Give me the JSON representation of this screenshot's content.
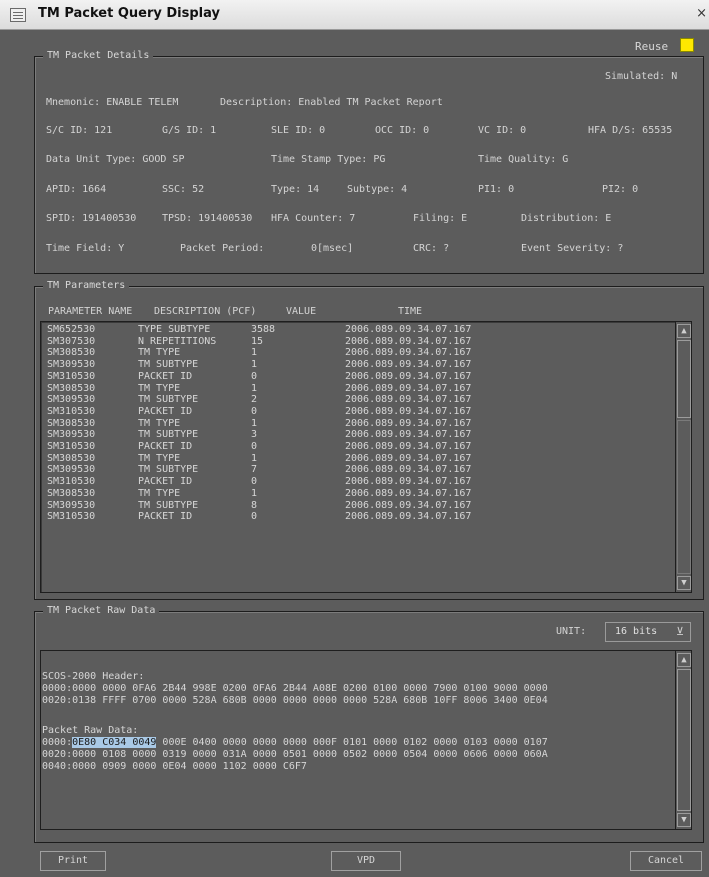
{
  "window": {
    "title": "TM Packet Query Display",
    "close_glyph": "×"
  },
  "reuse": {
    "label": "Reuse",
    "color": "#ffe800"
  },
  "details": {
    "group_label": "TM Packet Details",
    "simulated": "Simulated: N",
    "mnemonic": "Mnemonic: ENABLE TELEM",
    "description": "Description: Enabled TM Packet Report",
    "sc_id": "S/C ID: 121",
    "gs_id": "G/S ID: 1",
    "sle_id": "SLE ID: 0",
    "occ_id": "OCC ID: 0",
    "vc_id": "VC ID: 0",
    "hfa_ds": "HFA D/S: 65535",
    "data_unit_type": "Data Unit Type: GOOD SP",
    "time_stamp_type": "Time Stamp Type: PG",
    "time_quality": "Time Quality: G",
    "apid": "APID: 1664",
    "ssc": "SSC: 52",
    "type": "Type: 14",
    "subtype": "Subtype: 4",
    "pi1": "PI1: 0",
    "pi2": "PI2: 0",
    "spid": "SPID: 191400530",
    "tpsd": "TPSD: 191400530",
    "hfa_counter": "HFA Counter: 7",
    "filing": "Filing: E",
    "distribution": "Distribution: E",
    "time_field": "Time Field: Y",
    "packet_period_label": "Packet Period:",
    "packet_period_value": "0[msec]",
    "crc": "CRC: ?",
    "event_severity": "Event Severity: ?"
  },
  "parameters": {
    "group_label": "TM Parameters",
    "headers": [
      "PARAMETER NAME",
      "DESCRIPTION (PCF)",
      "VALUE",
      "TIME"
    ],
    "rows": [
      [
        "SM652530",
        "TYPE SUBTYPE",
        "3588",
        "2006.089.09.34.07.167"
      ],
      [
        "SM307530",
        "N REPETITIONS",
        "15",
        "2006.089.09.34.07.167"
      ],
      [
        "SM308530",
        "TM TYPE",
        "1",
        "2006.089.09.34.07.167"
      ],
      [
        "SM309530",
        "TM SUBTYPE",
        "1",
        "2006.089.09.34.07.167"
      ],
      [
        "SM310530",
        "PACKET ID",
        "0",
        "2006.089.09.34.07.167"
      ],
      [
        "SM308530",
        "TM TYPE",
        "1",
        "2006.089.09.34.07.167"
      ],
      [
        "SM309530",
        "TM SUBTYPE",
        "2",
        "2006.089.09.34.07.167"
      ],
      [
        "SM310530",
        "PACKET ID",
        "0",
        "2006.089.09.34.07.167"
      ],
      [
        "SM308530",
        "TM TYPE",
        "1",
        "2006.089.09.34.07.167"
      ],
      [
        "SM309530",
        "TM SUBTYPE",
        "3",
        "2006.089.09.34.07.167"
      ],
      [
        "SM310530",
        "PACKET ID",
        "0",
        "2006.089.09.34.07.167"
      ],
      [
        "SM308530",
        "TM TYPE",
        "1",
        "2006.089.09.34.07.167"
      ],
      [
        "SM309530",
        "TM SUBTYPE",
        "7",
        "2006.089.09.34.07.167"
      ],
      [
        "SM310530",
        "PACKET ID",
        "0",
        "2006.089.09.34.07.167"
      ],
      [
        "SM308530",
        "TM TYPE",
        "1",
        "2006.089.09.34.07.167"
      ],
      [
        "SM309530",
        "TM SUBTYPE",
        "8",
        "2006.089.09.34.07.167"
      ],
      [
        "SM310530",
        "PACKET ID",
        "0",
        "2006.089.09.34.07.167"
      ]
    ]
  },
  "raw": {
    "group_label": "TM Packet Raw Data",
    "unit_label": "UNIT:",
    "unit_value": "16 bits",
    "scos_header_title": "SCOS-2000 Header:",
    "scos_lines": [
      "0000:0000 0000 0FA6 2B44 998E 0200 0FA6 2B44 A08E 0200 0100 0000 7900 0100 9000 0000",
      "0020:0138 FFFF 0700 0000 528A 680B 0000 0000 0000 0000 528A 680B 10FF 8006 3400 0E04"
    ],
    "packet_title": "Packet Raw Data:",
    "packet_line0_prefix": "0000:",
    "packet_line0_selected": "0E80 C034 0049",
    "packet_line0_rest": " 000E 0400 0000 0000 0000 000F 0101 0000 0102 0000 0103 0000 0107",
    "packet_lines": [
      "0020:0000 0108 0000 0319 0000 031A 0000 0501 0000 0502 0000 0504 0000 0606 0000 060A",
      "0040:0000 0909 0000 0E04 0000 1102 0000 C6F7"
    ]
  },
  "buttons": {
    "print": "Print",
    "vpd": "VPD",
    "cancel": "Cancel"
  }
}
